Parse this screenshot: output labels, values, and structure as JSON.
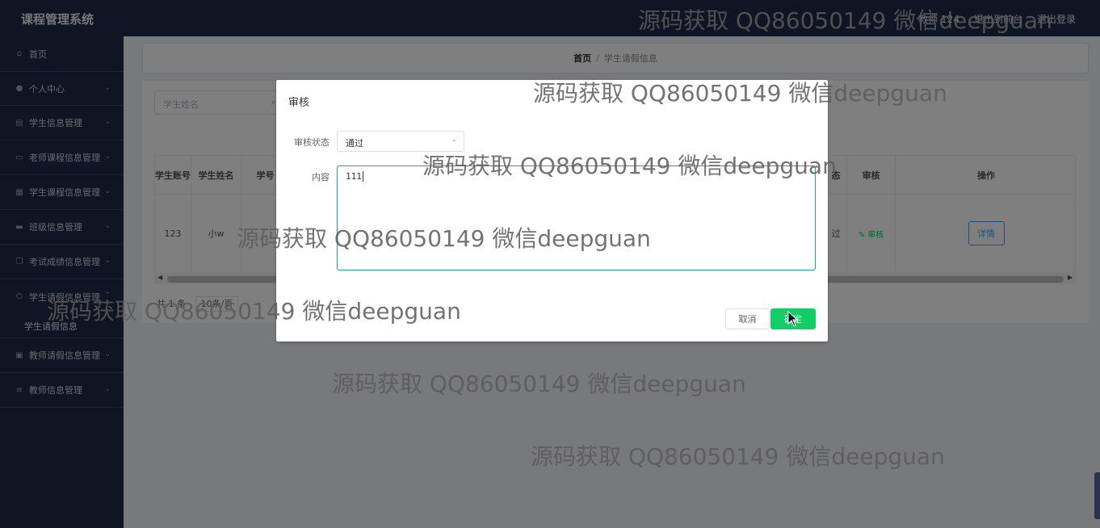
{
  "app": {
    "title": "课程管理系统",
    "user": "教师 124",
    "back_to_front": "退出到前台",
    "logout": "退出登录"
  },
  "sidebar": {
    "items": [
      {
        "label": "首页",
        "icon": "home-icon"
      },
      {
        "label": "个人中心",
        "icon": "user-icon"
      },
      {
        "label": "学生信息管理",
        "icon": "doc-icon"
      },
      {
        "label": "老师课程信息管理",
        "icon": "monitor-icon"
      },
      {
        "label": "学生课程信息管理",
        "icon": "grid-icon"
      },
      {
        "label": "班级信息管理",
        "icon": "chat-icon"
      },
      {
        "label": "考试成绩信息管理",
        "icon": "copy-icon"
      },
      {
        "label": "学生请假信息管理",
        "icon": "power-icon"
      },
      {
        "label": "学生请假信息",
        "sub": true
      },
      {
        "label": "教师请假信息管理",
        "icon": "chart-icon"
      },
      {
        "label": "教师信息管理",
        "icon": "sliders-icon"
      }
    ]
  },
  "breadcrumb": {
    "home": "首页",
    "separator": "/",
    "current": "学生请假信息"
  },
  "search": {
    "placeholder": "学生姓名"
  },
  "table": {
    "headers": [
      "学生账号",
      "学生姓名",
      "学号",
      "态",
      "审核",
      "操作"
    ],
    "row": {
      "account": "123",
      "name": "小w",
      "status_tail": "过",
      "audit": "审核",
      "detail": "详情"
    }
  },
  "pager": {
    "total": "共 1 条",
    "size": "10条/页"
  },
  "dialog": {
    "title": "审核",
    "status_label": "审核状态",
    "status_value": "通过",
    "content_label": "内容",
    "content_value": "111",
    "cancel": "取消",
    "confirm": "确定"
  },
  "watermark": "源码获取 QQ86050149 微信deepguan",
  "colors": {
    "sidebar": "#1f2a44",
    "primary_green": "#13ce66",
    "link_blue": "#409eff",
    "textarea_border": "#13a8a0"
  }
}
